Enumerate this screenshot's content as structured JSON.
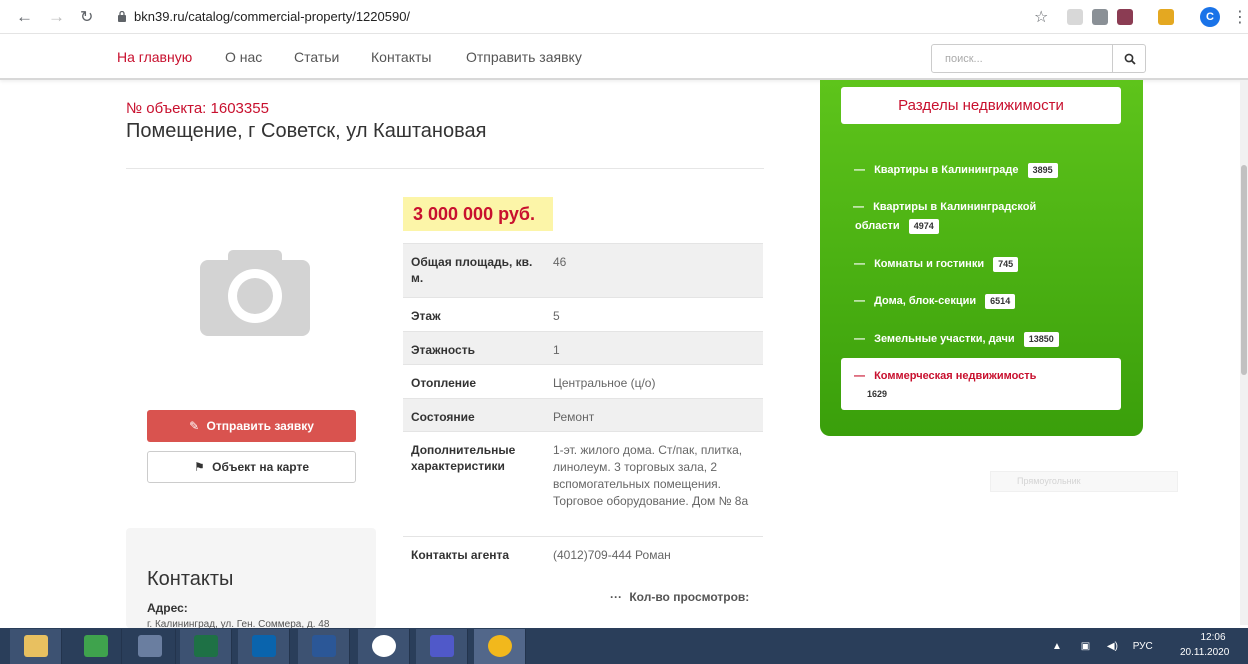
{
  "browser": {
    "url": "bkn39.ru/catalog/commercial-property/1220590/",
    "profile_initial": "C"
  },
  "nav": {
    "items": [
      "На главную",
      "О нас",
      "Статьи",
      "Контакты",
      "Отправить заявку"
    ],
    "search_placeholder": "поиск..."
  },
  "object": {
    "number": "№ объекта: 1603355",
    "title": "Помещение, г Советск, ул Каштановая",
    "price": "3 000 000 руб."
  },
  "properties": [
    {
      "key": "Общая площадь, кв. м.",
      "value": "46"
    },
    {
      "key": "Этаж",
      "value": "5"
    },
    {
      "key": "Этажность",
      "value": "1"
    },
    {
      "key": "Отопление",
      "value": "Центральное (ц/о)"
    },
    {
      "key": "Состояние",
      "value": "Ремонт"
    },
    {
      "key": "Дополнительные характеристики",
      "value": "1-эт. жилого дома. Ст/пак, плитка, линолеум. 3 торговых зала, 2 вспомогательных помещения. Торговое оборудование. Дом № 8а"
    },
    {
      "key": "Контакты агента",
      "value": "(4012)709-444 Роман"
    }
  ],
  "buttons": {
    "send": "Отправить заявку",
    "map": "Объект на карте"
  },
  "contacts": {
    "title": "Контакты",
    "address_label": "Адрес:",
    "address_value": "г. Калининград, ул. Ген. Соммера, д. 48"
  },
  "views_label": "Кол-во просмотров:",
  "sidebar": {
    "title": "Разделы недвижимости",
    "items": [
      {
        "label": "Квартиры в Калининграде",
        "count": "3895"
      },
      {
        "label": "Квартиры в Калининградской",
        "label2": "области",
        "count": "4974"
      },
      {
        "label": "Комнаты и гостинки",
        "count": "745"
      },
      {
        "label": "Дома, блок-секции",
        "count": "6514"
      },
      {
        "label": "Земельные участки, дачи",
        "count": "13850"
      }
    ],
    "active": {
      "label": "Коммерческая недвижимость",
      "count": "1629"
    }
  },
  "ghost_label": "Прямоугольник",
  "taskbar": {
    "lang": "РУС",
    "time": "12:06",
    "date": "20.11.2020"
  },
  "colors": {
    "brand_red": "#c8102e",
    "sidebar_green": "#4cb214",
    "price_bg": "#fcf5a8",
    "send_button": "#d9534f"
  }
}
